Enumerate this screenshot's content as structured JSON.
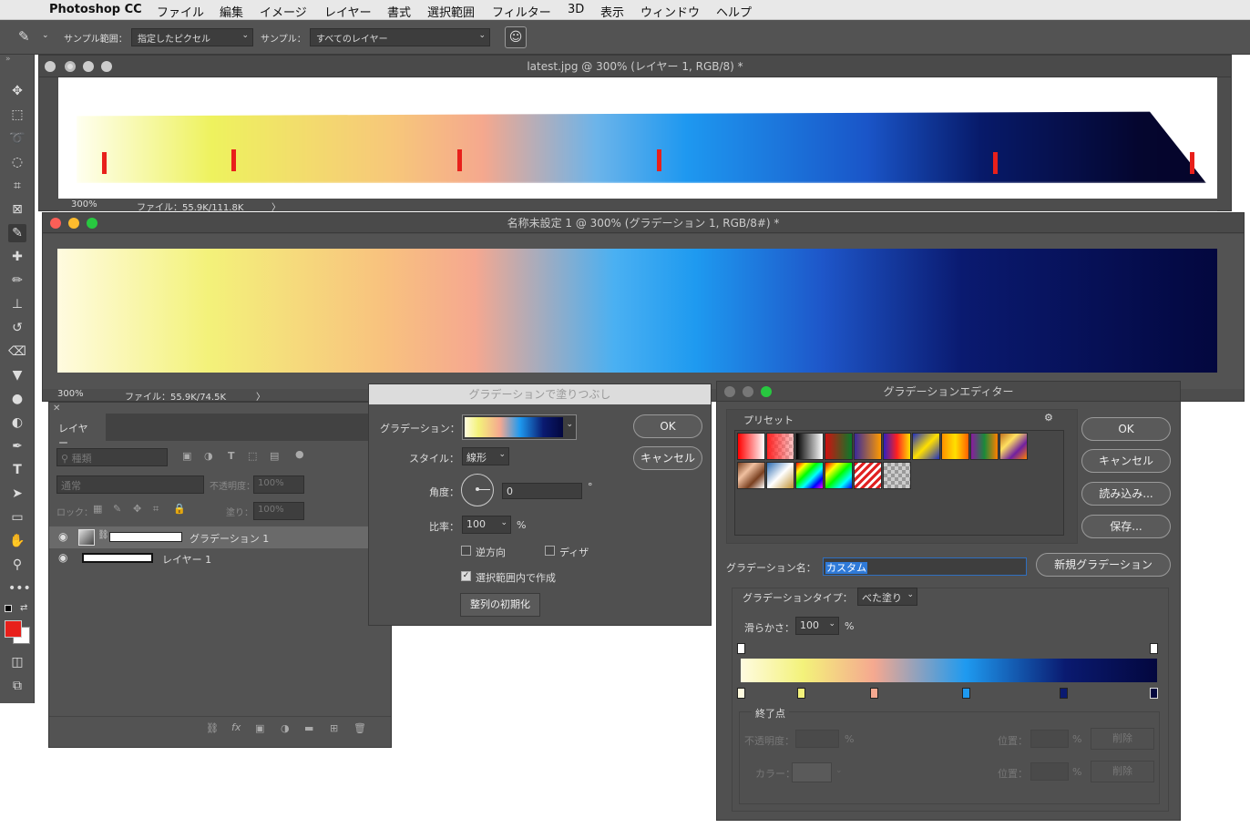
{
  "menubar": {
    "app": "Photoshop CC",
    "items": [
      "ファイル",
      "編集",
      "イメージ",
      "レイヤー",
      "書式",
      "選択範囲",
      "フィルター",
      "3D",
      "表示",
      "ウィンドウ",
      "ヘルプ"
    ]
  },
  "options": {
    "sample_size_label": "サンプル範囲：",
    "sample_size_value": "指定したピクセル",
    "sample_label": "サンプル：",
    "sample_value": "すべてのレイヤー"
  },
  "doc1": {
    "title": "latest.jpg @ 300% (レイヤー 1, RGB/8) *",
    "zoom": "300%",
    "file": "ファイル：55.9K/111.8K",
    "arrow": "〉"
  },
  "doc2": {
    "title": "名称未設定 1 @ 300% (グラデーション 1, RGB/8#) *",
    "zoom": "300%",
    "file": "ファイル：55.9K/74.5K",
    "arrow": "〉"
  },
  "layers": {
    "tab": "レイヤー",
    "filter_placeholder": "種類",
    "blend_mode": "通常",
    "opacity_label": "不透明度：",
    "opacity": "100%",
    "lock_label": "ロック：",
    "fill_label": "塗り：",
    "fill": "100%",
    "items": [
      {
        "name": "グラデーション 1"
      },
      {
        "name": "レイヤー 1"
      }
    ]
  },
  "gradient_fill": {
    "title": "グラデーションで塗りつぶし",
    "gradient_label": "グラデーション：",
    "style_label": "スタイル：",
    "style_value": "線形",
    "angle_label": "角度：",
    "angle_value": "0",
    "angle_unit": "°",
    "scale_label": "比率：",
    "scale_value": "100",
    "scale_unit": "%",
    "reverse_label": "逆方向",
    "dither_label": "ディザ",
    "align_label": "選択範囲内で作成",
    "reset_label": "整列の初期化",
    "ok": "OK",
    "cancel": "キャンセル"
  },
  "gradient_editor": {
    "title": "グラデーションエディター",
    "presets_label": "プリセット",
    "ok": "OK",
    "cancel": "キャンセル",
    "load": "読み込み...",
    "save": "保存...",
    "name_label": "グラデーション名：",
    "name_value": "カスタム",
    "new_button": "新規グラデーション",
    "type_label": "グラデーションタイプ：",
    "type_value": "べた塗り",
    "smooth_label": "滑らかさ：",
    "smooth_value": "100",
    "smooth_unit": "%",
    "stops_group": "終了点",
    "opacity_label": "不透明度：",
    "color_label": "カラー：",
    "position_label": "位置：",
    "percent": "%",
    "delete_label": "削除"
  },
  "colors": {
    "foreground": "#e8201b",
    "background": "#ffffff",
    "accent_blue": "#2f7ad8"
  },
  "gradient_stops": [
    "#fffbe0",
    "#f3f27a",
    "#f5a890",
    "#1e9af0",
    "#0a1a70",
    "#03073e"
  ]
}
